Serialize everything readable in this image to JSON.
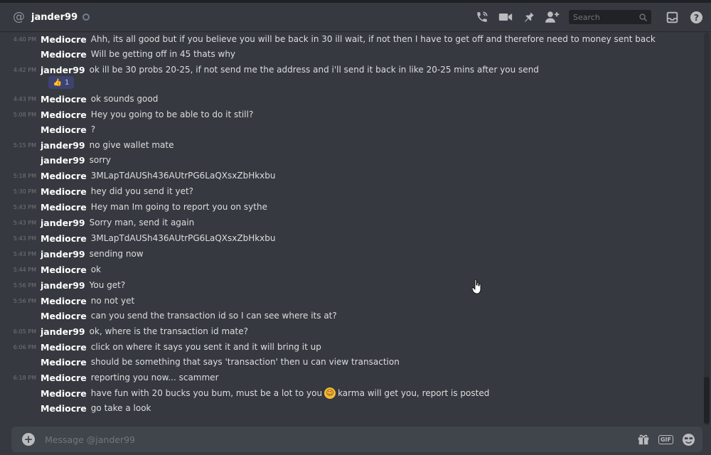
{
  "header": {
    "at_symbol": "@",
    "username": "jander99",
    "search_placeholder": "Search"
  },
  "icons": {
    "call": "phone-call-icon",
    "video": "video-icon",
    "pin": "pin-icon",
    "add_member": "add-member-icon",
    "search": "search-icon",
    "inbox": "inbox-icon",
    "help": "help-icon",
    "add": "plus-circle-icon",
    "gift": "gift-icon",
    "gif": "gif-icon",
    "emoji": "emoji-icon"
  },
  "messages": [
    {
      "time": "4:40 PM",
      "author": "Mediocre",
      "text": "Ahh, its all good but if you believe you will be back in 30 ill wait, if not then I have to get off and therefore need to money sent back"
    },
    {
      "time": "",
      "author": "Mediocre",
      "text": "Will be getting off in 45 thats why"
    },
    {
      "time": "4:42 PM",
      "author": "jander99",
      "text": "ok ill be 30 probs 20-25, if not send me the address and i'll send it back in like 20-25 mins after you send"
    },
    {
      "time": "4:43 PM",
      "author": "Mediocre",
      "text": "ok sounds good"
    },
    {
      "time": "5:08 PM",
      "author": "Mediocre",
      "text": "Hey you going to be able to do it still?"
    },
    {
      "time": "",
      "author": "Mediocre",
      "text": "?"
    },
    {
      "time": "5:15 PM",
      "author": "jander99",
      "text": "no give wallet mate"
    },
    {
      "time": "",
      "author": "jander99",
      "text": "sorry"
    },
    {
      "time": "5:18 PM",
      "author": "Mediocre",
      "text": "3MLapTdAUSh436AUtrPG6LaQXsxZbHkxbu"
    },
    {
      "time": "5:30 PM",
      "author": "Mediocre",
      "text": "hey did you send it yet?"
    },
    {
      "time": "5:43 PM",
      "author": "Mediocre",
      "text": "Hey man Im going to report you on sythe"
    },
    {
      "time": "5:43 PM",
      "author": "jander99",
      "text": "Sorry man, send it again"
    },
    {
      "time": "5:43 PM",
      "author": "Mediocre",
      "text": "3MLapTdAUSh436AUtrPG6LaQXsxZbHkxbu"
    },
    {
      "time": "5:43 PM",
      "author": "jander99",
      "text": "sending now"
    },
    {
      "time": "5:44 PM",
      "author": "Mediocre",
      "text": "ok"
    },
    {
      "time": "5:56 PM",
      "author": "jander99",
      "text": "You get?"
    },
    {
      "time": "5:56 PM",
      "author": "Mediocre",
      "text": "no not yet"
    },
    {
      "time": "",
      "author": "Mediocre",
      "text": "can you send the transaction id so I can see where its at?"
    },
    {
      "time": "6:05 PM",
      "author": "jander99",
      "text": "ok, where is the transaction id mate?"
    },
    {
      "time": "6:06 PM",
      "author": "Mediocre",
      "text": "click on where it says you sent it and it will bring it up"
    },
    {
      "time": "",
      "author": "Mediocre",
      "text": "should be something that says 'transaction' then u can view transaction"
    },
    {
      "time": "6:18 PM",
      "author": "Mediocre",
      "text": "reporting you now... scammer"
    },
    {
      "time": "",
      "author": "Mediocre",
      "text": "have fun with 20 bucks you bum, must be a lot to you",
      "emoji": "😉",
      "text2": "karma will get you, report is posted"
    },
    {
      "time": "",
      "author": "Mediocre",
      "text": "go take a look"
    }
  ],
  "reaction": {
    "emoji": "👍",
    "count": "1"
  },
  "composer": {
    "placeholder": "Message @jander99",
    "gif_label": "GIF",
    "plus": "+"
  }
}
